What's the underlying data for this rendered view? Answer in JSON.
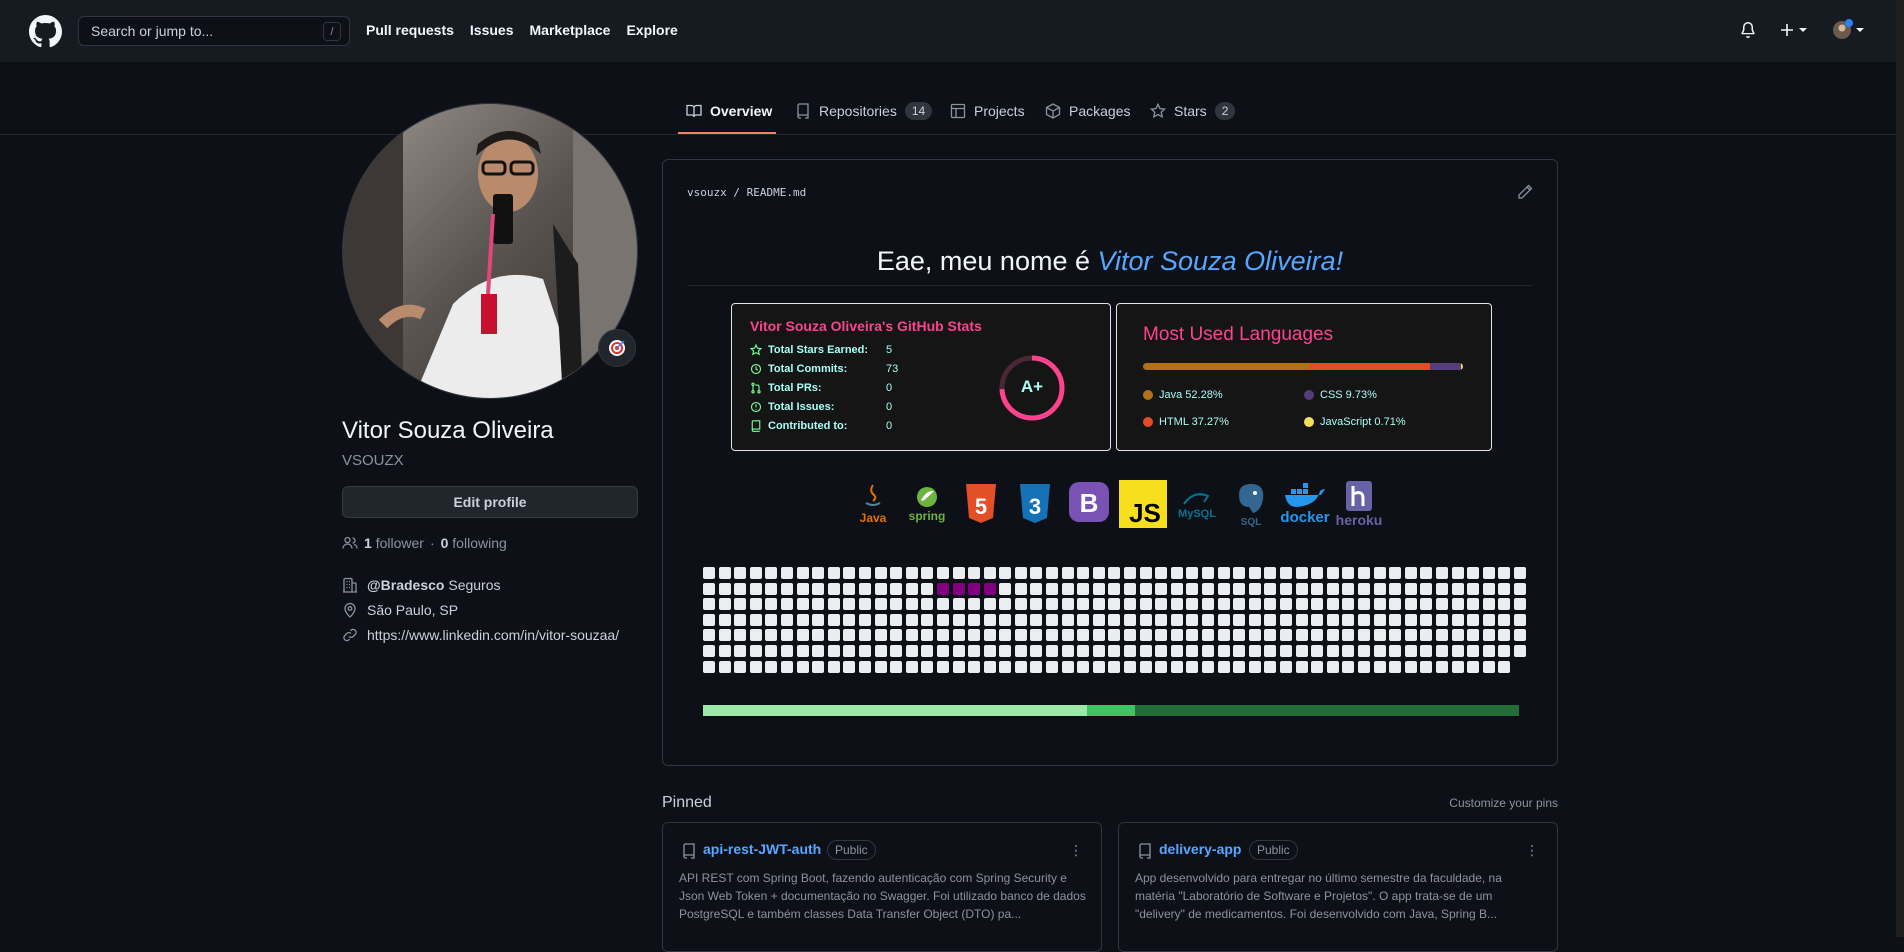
{
  "header": {
    "search_placeholder": "Search or jump to...",
    "search_shortcut": "/",
    "nav": [
      "Pull requests",
      "Issues",
      "Marketplace",
      "Explore"
    ]
  },
  "tabs": [
    {
      "label": "Overview",
      "icon": "book-icon",
      "active": true
    },
    {
      "label": "Repositories",
      "icon": "repo-icon",
      "count": "14"
    },
    {
      "label": "Projects",
      "icon": "project-icon"
    },
    {
      "label": "Packages",
      "icon": "package-icon"
    },
    {
      "label": "Stars",
      "icon": "star-icon",
      "count": "2"
    }
  ],
  "profile": {
    "name": "Vitor Souza Oliveira",
    "login": "VSOUZX",
    "edit_label": "Edit profile",
    "followers_count": "1",
    "followers_label": "follower",
    "separator": "·",
    "following_count": "0",
    "following_label": "following",
    "company_org": "@Bradesco",
    "company_rest": "Seguros",
    "location": "São Paulo, SP",
    "website": "https://www.linkedin.com/in/vitor-souzaa/"
  },
  "readme": {
    "path_user": "vsouzx",
    "path_sep": "/",
    "path_file": "README.md",
    "title_prefix": "Eae, meu nome é ",
    "title_name": "Vitor Souza Oliveira!",
    "stats": {
      "title": "Vitor Souza Oliveira's GitHub Stats",
      "rows": [
        {
          "label": "Total Stars Earned:",
          "value": "5"
        },
        {
          "label": "Total Commits:",
          "value": "73"
        },
        {
          "label": "Total PRs:",
          "value": "0"
        },
        {
          "label": "Total Issues:",
          "value": "0"
        },
        {
          "label": "Contributed to:",
          "value": "0"
        }
      ],
      "grade": "A+"
    },
    "languages": {
      "title": "Most Used Languages",
      "items": [
        {
          "name": "Java 52.28%",
          "color": "#b07219",
          "pct": 52.28
        },
        {
          "name": "HTML 37.27%",
          "color": "#e34c26",
          "pct": 37.27
        },
        {
          "name": "CSS 9.73%",
          "color": "#563d7c",
          "pct": 9.73
        },
        {
          "name": "JavaScript 0.71%",
          "color": "#f1e05a",
          "pct": 0.71
        }
      ]
    },
    "tech_logos": [
      {
        "name": "Java",
        "icon": "java-icon",
        "color": "#e76f00"
      },
      {
        "name": "spring",
        "icon": "spring-icon",
        "color": "#6db33f"
      },
      {
        "name": "5",
        "icon": "html5-icon",
        "color": "#e34f26"
      },
      {
        "name": "3",
        "icon": "css3-icon",
        "color": "#1572b6"
      },
      {
        "name": "B",
        "icon": "bootstrap-icon",
        "color": "#7952b3"
      },
      {
        "name": "JS",
        "icon": "javascript-icon",
        "color": "#f7df1e"
      },
      {
        "name": "MySQL",
        "icon": "mysql-icon",
        "color": "#00758f"
      },
      {
        "name": "SQL",
        "icon": "postgresql-icon",
        "color": "#336791"
      },
      {
        "name": "docker",
        "icon": "docker-icon",
        "color": "#2496ed"
      },
      {
        "name": "heroku",
        "icon": "heroku-icon",
        "color": "#6762a6"
      }
    ],
    "progress_segments": [
      {
        "color": "#9be9a8",
        "fraction": 0.47
      },
      {
        "color": "#40c463",
        "fraction": 0.06
      },
      {
        "color": "#216e39",
        "fraction": 0.47
      }
    ]
  },
  "pinned": {
    "title": "Pinned",
    "customize": "Customize your pins",
    "items": [
      {
        "name": "api-rest-JWT-auth",
        "badge": "Public",
        "desc": "API REST com Spring Boot, fazendo autenticação com Spring Security e Json Web Token + documentação no Swagger. Foi utilizado banco de dados PostgreSQL e também classes Data Transfer Object (DTO) pa..."
      },
      {
        "name": "delivery-app",
        "badge": "Public",
        "desc": "App desenvolvido para entregar no último semestre da faculdade, na matéria \"Laboratório de Software e Projetos\". O app trata-se de um \"delivery\" de medicamentos. Foi desenvolvido com Java, Spring B..."
      }
    ]
  }
}
